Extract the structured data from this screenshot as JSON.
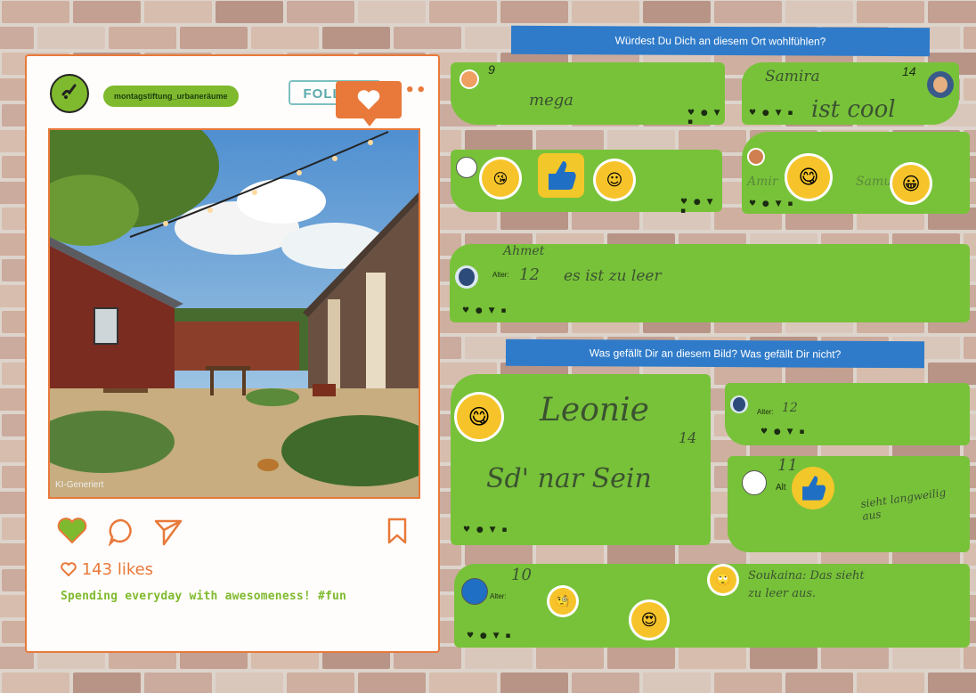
{
  "post": {
    "handle": "montagstiftung_urbaneräume",
    "follow_label": "FOLLOW",
    "more_label": "•••",
    "photo_credit": "KI-Generiert",
    "likes_text": "143 likes",
    "caption": "Spending everyday with awesomeness! #fun",
    "accent_color": "#e8793a",
    "brand_green": "#7fba2e"
  },
  "banners": [
    {
      "text": "Würdest Du Dich an diesem Ort wohlfühlen?"
    },
    {
      "text": "Was gefällt Dir an diesem Bild? Was gefällt Dir nicht?"
    }
  ],
  "notes": [
    {
      "handwriting": "mega",
      "age": "9"
    },
    {
      "handwriting": "ist cool",
      "name": "Samira",
      "age": "14"
    },
    {
      "handwriting": "",
      "name": "Amir",
      "name2": "Samu"
    },
    {
      "handwriting": "es ist zu leer",
      "age_label": "Alter:",
      "age": "12",
      "name": "Ahmet"
    },
    {
      "handwriting": "Leonie",
      "handwriting2": "Sd' nar Sein",
      "age": "14"
    },
    {
      "age_label": "Alter:",
      "age": "12"
    },
    {
      "age_label": "Alt",
      "age": "11",
      "handwriting": "sieht langweilig aus"
    },
    {
      "age_label": "Alter:",
      "age": "10",
      "handwriting": "Soukaina: Das sieht",
      "handwriting2": "zu leer aus."
    }
  ],
  "icons": [
    "heart-icon",
    "comment-icon",
    "send-icon",
    "bookmark-icon",
    "thumbs-up-icon"
  ]
}
